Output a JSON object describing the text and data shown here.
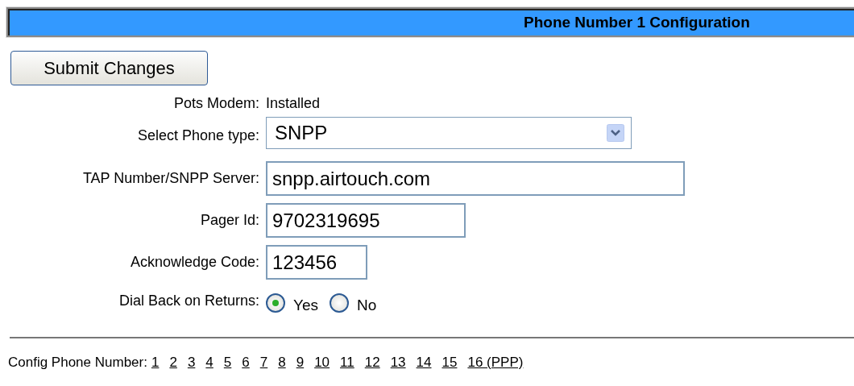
{
  "header": {
    "title": "Phone Number 1 Configuration"
  },
  "submit_button": "Submit Changes",
  "form": [
    {
      "kind": "info",
      "label": "Pots Modem:",
      "value": "Installed"
    },
    {
      "kind": "select",
      "label": "Select Phone type:",
      "value": "SNPP"
    },
    {
      "kind": "text",
      "label": "TAP Number/SNPP Server:",
      "value": "snpp.airtouch.com"
    },
    {
      "kind": "text",
      "label": "Pager Id:",
      "value": "9702319695"
    },
    {
      "kind": "text",
      "label": "Acknowledge Code:",
      "value": "123456"
    },
    {
      "kind": "radio",
      "label": "Dial Back on Returns:",
      "options": [
        {
          "label": "Yes",
          "selected": true
        },
        {
          "label": "No",
          "selected": false
        }
      ]
    }
  ],
  "footer": {
    "label": "Config Phone Number:",
    "links": [
      "1",
      "2",
      "3",
      "4",
      "5",
      "6",
      "7",
      "8",
      "9",
      "10",
      "11",
      "12",
      "13",
      "14",
      "15",
      "16 (PPP)"
    ]
  }
}
